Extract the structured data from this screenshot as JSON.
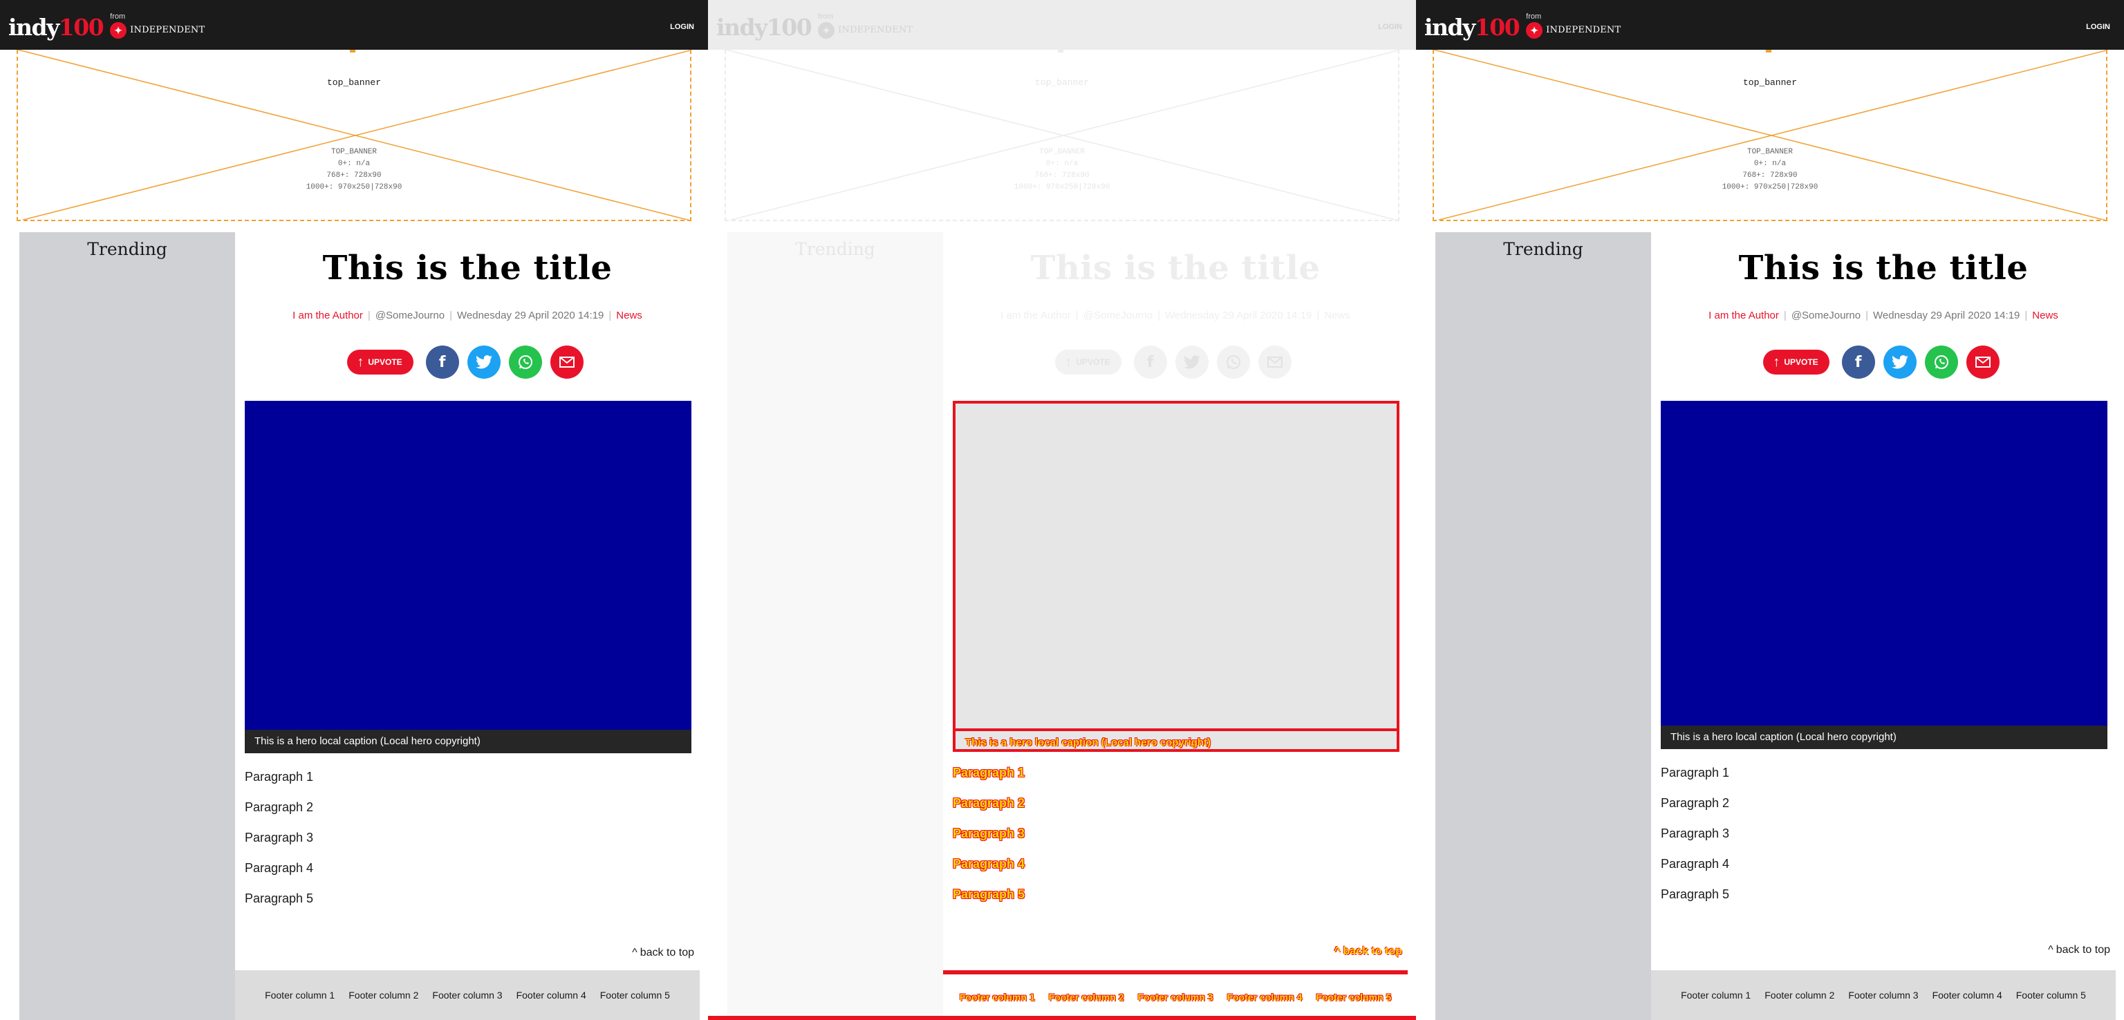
{
  "header": {
    "logo_main": "indy",
    "logo_num": "100",
    "from_label": "from",
    "publisher": "INDEPENDENT",
    "login_label": "LOGIN"
  },
  "banner": {
    "slot_name": "top_banner",
    "spec_lines": [
      "TOP_BANNER",
      "0+: n/a",
      "768+: 728x90",
      "1000+: 970x250|728x90"
    ],
    "outline_color": "#f0a030"
  },
  "sidebar": {
    "title": "Trending"
  },
  "article": {
    "title": "This is the title",
    "author": "I am the Author",
    "twitter": "@SomeJourno",
    "date": "Wednesday 29 April 2020 14:19",
    "section": "News"
  },
  "share": {
    "upvote_label": "UPVOTE",
    "facebook_glyph": "f",
    "buttons": [
      "facebook-icon",
      "twitter-icon",
      "whatsapp-icon",
      "email-icon"
    ]
  },
  "hero": {
    "caption": "This is a hero local caption (Local hero copyright)",
    "image_color": "#000099"
  },
  "paragraphs": [
    "Paragraph 1",
    "Paragraph 2",
    "Paragraph 3",
    "Paragraph 4",
    "Paragraph 5"
  ],
  "back_to_top": "back to top",
  "footer": {
    "columns": [
      "Footer column 1",
      "Footer column 2",
      "Footer column 3",
      "Footer column 4",
      "Footer column 5"
    ]
  },
  "colors": {
    "brand_red": "#e8132a",
    "header_bg": "#1b1b1b",
    "sidebar_bg": "#d0d1d5",
    "debug_outline": "#e8131e",
    "debug_text": "#ffd600"
  }
}
